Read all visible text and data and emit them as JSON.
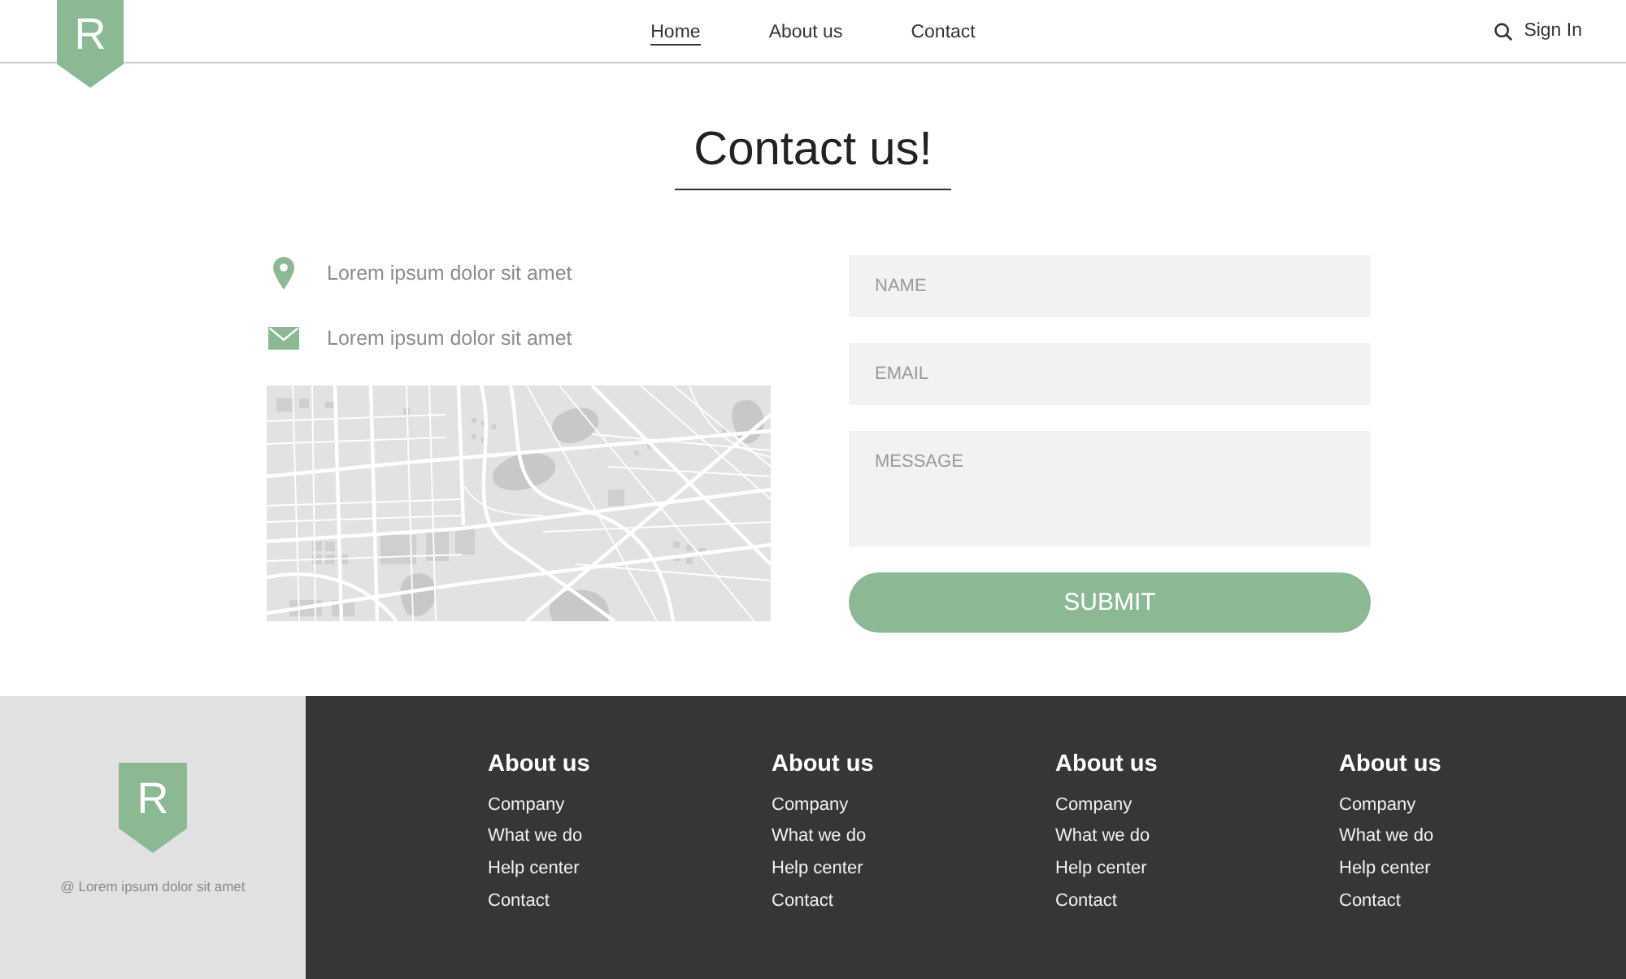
{
  "header": {
    "logo": "R",
    "nav": [
      {
        "label": "Home",
        "selected": true
      },
      {
        "label": "About us",
        "selected": false
      },
      {
        "label": "Contact",
        "selected": false
      }
    ],
    "sign_in": "Sign In"
  },
  "contact": {
    "title": "Contact us!",
    "info": [
      {
        "kind": "location",
        "text": "Lorem ipsum dolor sit amet"
      },
      {
        "kind": "email",
        "text": "Lorem ipsum dolor sit amet"
      }
    ],
    "form": {
      "fields": [
        {
          "kind": "input",
          "placeholder": "NAME"
        },
        {
          "kind": "input",
          "placeholder": "EMAIL"
        },
        {
          "kind": "textarea",
          "placeholder": "MESSAGE"
        }
      ],
      "submit": "SUBMIT"
    }
  },
  "footer": {
    "logo": "R",
    "tagline": "@ Lorem ipsum dolor sit amet",
    "columns": [
      {
        "heading": "About us",
        "links": [
          "Company",
          "What we do",
          "Help center",
          "Contact"
        ]
      },
      {
        "heading": "About us",
        "links": [
          "Company",
          "What we do",
          "Help center",
          "Contact"
        ]
      },
      {
        "heading": "About us",
        "links": [
          "Company",
          "What we do",
          "Help center",
          "Contact"
        ]
      },
      {
        "heading": "About us",
        "links": [
          "Company",
          "What we do",
          "Help center",
          "Contact"
        ]
      }
    ]
  }
}
